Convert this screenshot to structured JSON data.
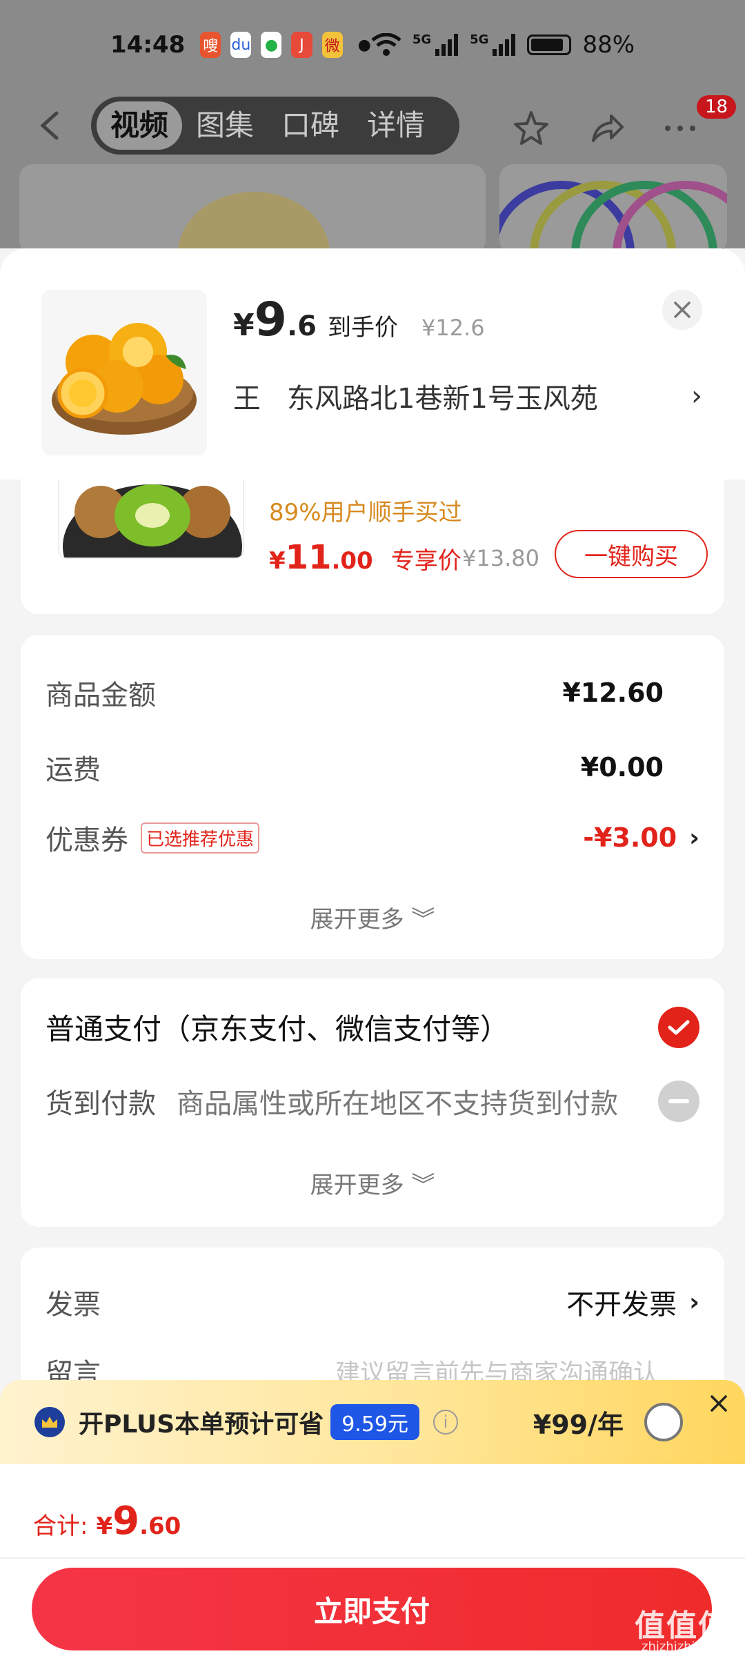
{
  "status_bar": {
    "time": "14:48",
    "battery": "88%",
    "network": "5G",
    "battery_level": 0.88
  },
  "background_page": {
    "tabs": [
      "视频",
      "图集",
      "口碑",
      "详情"
    ],
    "active_tab": 0,
    "notification_count": "18"
  },
  "product": {
    "price_yen": "¥",
    "price_int": "9",
    "price_dec": ".6",
    "price_tag": "到手价",
    "original_price": "¥12.6"
  },
  "address": {
    "name": "王",
    "detail": "东风路北1巷新1号玉风苑"
  },
  "recommended": {
    "bought_text": "89%用户顺手买过",
    "price_yen": "¥",
    "price_int": "11",
    "price_dec": ".00",
    "price_tag": "专享价",
    "original_price": "¥13.80",
    "buy_label": "一键购买"
  },
  "amounts": {
    "goods_label": "商品金额",
    "goods_value": "¥12.60",
    "shipping_label": "运费",
    "shipping_value": "¥0.00",
    "coupon_label": "优惠券",
    "coupon_tag": "已选推荐优惠",
    "coupon_value": "-¥3.00",
    "expand_label": "展开更多"
  },
  "payment": {
    "normal_label": "普通支付（京东支付、微信支付等）",
    "cod_label": "货到付款",
    "cod_note": "商品属性或所在地区不支持货到付款",
    "expand_label": "展开更多"
  },
  "invoice": {
    "label": "发票",
    "value": "不开发票",
    "note_label": "留言",
    "note_placeholder": "建议留言前先与商家沟通确认"
  },
  "plus": {
    "text": "开PLUS本单预计可省",
    "saving": "9.59元",
    "price": "¥99/年"
  },
  "total": {
    "label": "合计:",
    "yen": "¥",
    "int": "9",
    "dec": ".60",
    "pay_label": "立即支付"
  },
  "watermark": {
    "text": "值值值",
    "sub": "zhizhizhi.com"
  },
  "colors": {
    "accent_red": "#e2231a",
    "plus_blue": "#1e56e6",
    "bought_orange": "#d78a1f"
  }
}
